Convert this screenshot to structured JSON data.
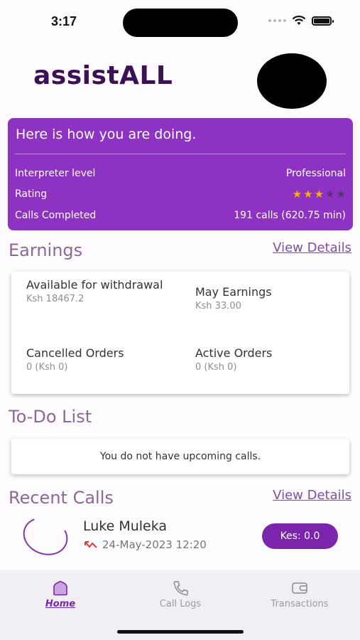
{
  "status_bar": {
    "time": "3:17"
  },
  "header": {
    "app_name": "assistALL"
  },
  "summary": {
    "title": "Here is  how you are doing.",
    "rows": [
      {
        "label": "Interpreter level",
        "value": "Professional"
      },
      {
        "label": "Rating",
        "rating": 3,
        "max_rating": 5
      },
      {
        "label": "Calls Completed",
        "value": "191 calls (620.75 min)"
      }
    ]
  },
  "earnings": {
    "title": "Earnings",
    "view_details": "View Details",
    "items": [
      {
        "label": "Available for withdrawal",
        "value": "Ksh 18467.2"
      },
      {
        "label": "May Earnings",
        "value": "Ksh 33.00"
      },
      {
        "label": "Cancelled Orders",
        "value": "0 (Ksh 0)"
      },
      {
        "label": "Active Orders",
        "value": "0 (Ksh 0)"
      }
    ]
  },
  "todo": {
    "title": "To-Do List",
    "empty_message": "You do not have upcoming calls."
  },
  "recent_calls": {
    "title": "Recent Calls",
    "view_details": "View Details",
    "calls": [
      {
        "name": "Luke Muleka",
        "datetime": "24-May-2023 12:20",
        "amount": "Kes: 0.0",
        "status_icon": "missed-call-icon"
      }
    ]
  },
  "nav": {
    "items": [
      {
        "label": "Home",
        "icon": "home-icon",
        "active": true
      },
      {
        "label": "Call Logs",
        "icon": "phone-icon",
        "active": false
      },
      {
        "label": "Transactions",
        "icon": "wallet-icon",
        "active": false
      }
    ]
  },
  "colors": {
    "brand_purple": "#8e32c3",
    "accent_purple": "#7b25ad",
    "logo": "#3b1153",
    "star": "#f5b400",
    "missed_call": "#e53935"
  }
}
